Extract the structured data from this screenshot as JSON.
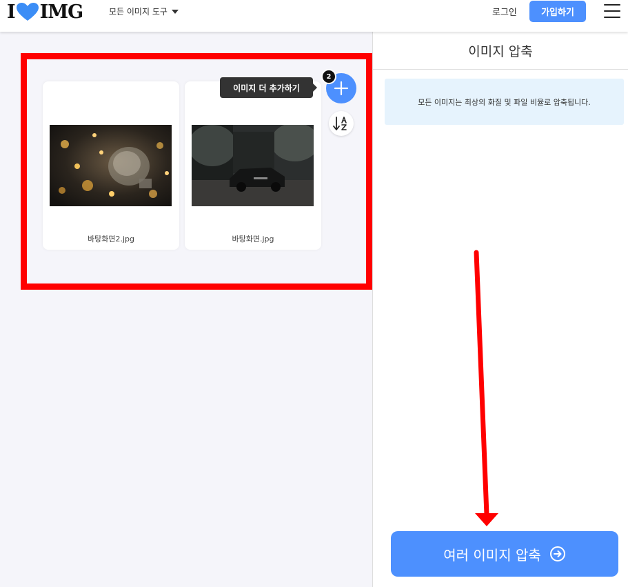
{
  "header": {
    "logo": {
      "left": "I",
      "right": "IMG"
    },
    "tools_menu_label": "모든 이미지 도구",
    "login_label": "로그인",
    "signup_label": "가입하기"
  },
  "workspace": {
    "files": [
      {
        "name": "바탕화면2.jpg"
      },
      {
        "name": "바탕화면.jpg"
      }
    ],
    "add_tooltip": "이미지 더 추가하기",
    "file_count_badge": "2"
  },
  "sidebar": {
    "title": "이미지 압축",
    "info_text": "모든 이미지는 최상의 화질 및 파일 비율로 압축됩니다.",
    "compress_button_label": "여러 이미지 압축"
  },
  "colors": {
    "accent": "#4d90fe",
    "highlight": "#ff0000",
    "info_bg": "#e6f3fd"
  },
  "icons": [
    "heart-logo-icon",
    "caret-down-icon",
    "hamburger-icon",
    "plus-icon",
    "sort-az-icon",
    "arrow-circle-right-icon"
  ]
}
